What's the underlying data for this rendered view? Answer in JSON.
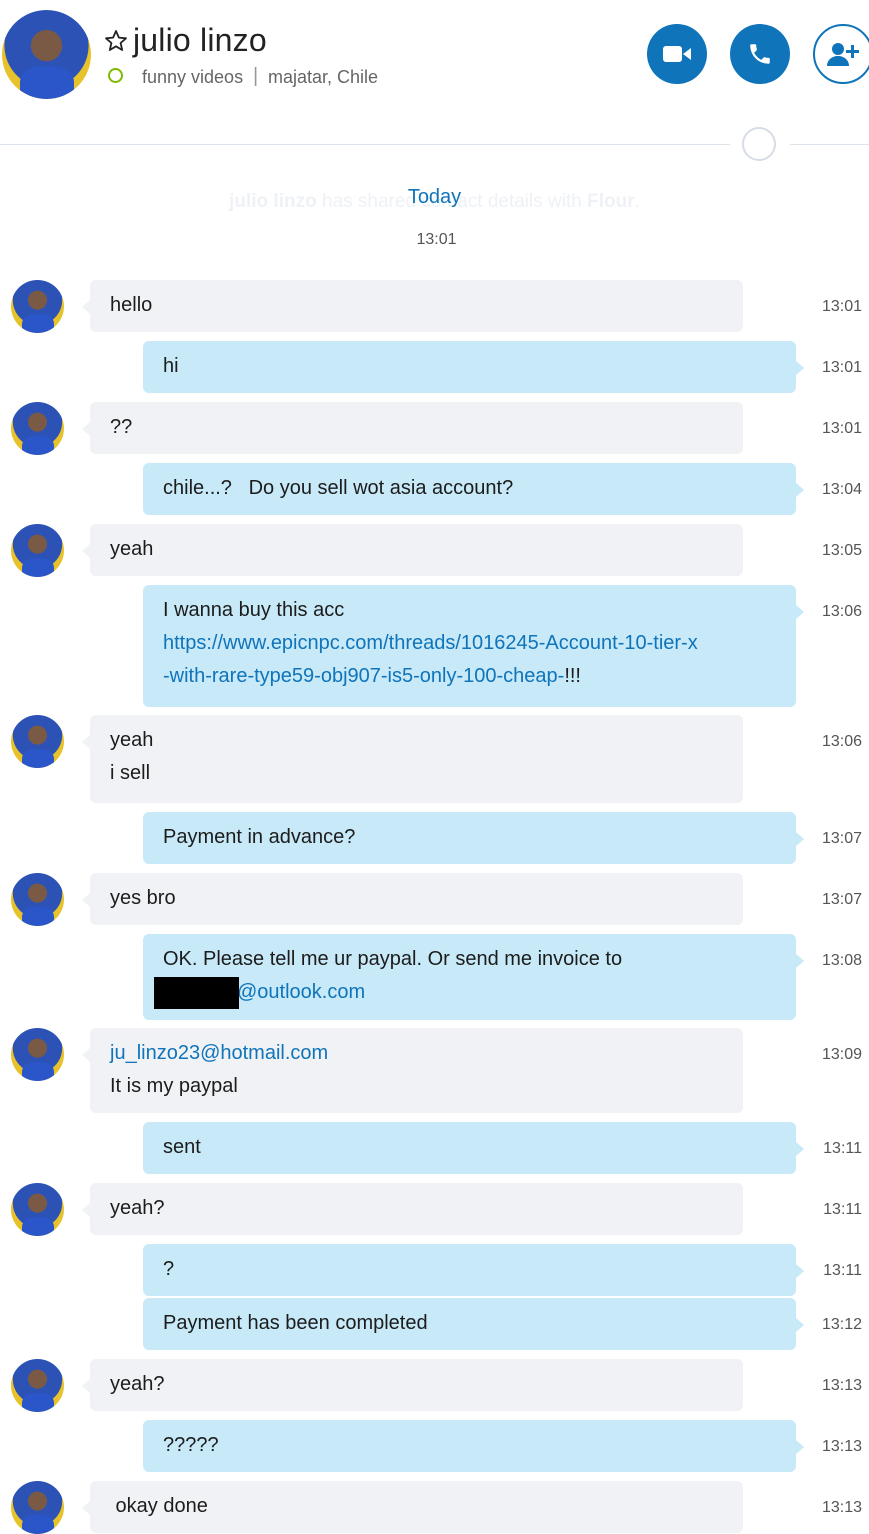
{
  "header": {
    "contact_name": "julio linzo",
    "mood": "funny videos",
    "separator": "|",
    "location": "majatar, Chile",
    "colors": {
      "accent": "#0f74b9",
      "presence": "#7fba00"
    }
  },
  "system": {
    "today_label": "Today",
    "shared_name": "julio linzo",
    "shared_text": " has shared contact details with ",
    "shared_target": "Flour",
    "shared_end": ".",
    "time": "13:01"
  },
  "messages": [
    {
      "dir": "in",
      "lines": [
        "hello"
      ],
      "time": "13:01"
    },
    {
      "dir": "out",
      "lines": [
        "hi"
      ],
      "time": "13:01"
    },
    {
      "dir": "in",
      "lines": [
        "??"
      ],
      "time": "13:01"
    },
    {
      "dir": "out",
      "lines": [
        "chile...?   Do you sell wot asia account?"
      ],
      "time": "13:04"
    },
    {
      "dir": "in",
      "lines": [
        "yeah"
      ],
      "time": "13:05"
    },
    {
      "dir": "out",
      "lines": [
        "I wanna buy this acc"
      ],
      "link1": "https://www.epicnpc.com/threads/1016245-Account-10-tier-x",
      "link2": "-with-rare-type59-obj907-is5-only-100-cheap-",
      "after_link": "!!!",
      "time": "13:06"
    },
    {
      "dir": "in",
      "lines": [
        "yeah",
        "i sell"
      ],
      "time": "13:06"
    },
    {
      "dir": "out",
      "lines": [
        "Payment in advance?"
      ],
      "time": "13:07"
    },
    {
      "dir": "in",
      "lines": [
        "yes bro"
      ],
      "time": "13:07"
    },
    {
      "dir": "out",
      "lines": [
        "OK. Please tell me ur paypal. Or send me invoice to"
      ],
      "link_email": "@outlook.com",
      "time": "13:08"
    },
    {
      "dir": "in",
      "link_top": "ju_linzo23@hotmail.com",
      "lines": [
        "It is my paypal"
      ],
      "time": "13:09"
    },
    {
      "dir": "out",
      "lines": [
        "sent"
      ],
      "time": "13:11"
    },
    {
      "dir": "in",
      "lines": [
        "yeah?"
      ],
      "time": "13:11"
    },
    {
      "dir": "out",
      "lines": [
        "?"
      ],
      "time": "13:11"
    },
    {
      "dir": "out",
      "lines": [
        "Payment has been completed"
      ],
      "time": "13:12"
    },
    {
      "dir": "in",
      "lines": [
        "yeah?"
      ],
      "time": "13:13"
    },
    {
      "dir": "out",
      "lines": [
        "?????"
      ],
      "time": "13:13"
    },
    {
      "dir": "in",
      "lines": [
        " okay done"
      ],
      "time": "13:13"
    }
  ]
}
